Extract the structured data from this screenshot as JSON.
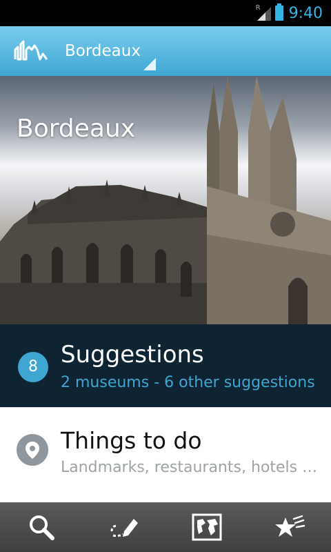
{
  "status_bar": {
    "time": "9:40",
    "roaming": "R",
    "accent": "#33b5e5"
  },
  "action_bar": {
    "city": "Bordeaux",
    "logo_icon": "city-skyline-logo",
    "color": "#3fa6d2"
  },
  "hero": {
    "title": "Bordeaux"
  },
  "suggestions": {
    "count": "8",
    "title": "Suggestions",
    "subtitle": "2 museums - 6 other suggestions"
  },
  "things_to_do": {
    "title": "Things to do",
    "subtitle": "Landmarks, restaurants, hotels …",
    "icon": "location-pin-icon"
  },
  "bottom_nav": [
    {
      "icon": "search-icon"
    },
    {
      "icon": "itinerary-pencil-icon"
    },
    {
      "icon": "world-map-icon"
    },
    {
      "icon": "favorites-stars-icon"
    }
  ]
}
